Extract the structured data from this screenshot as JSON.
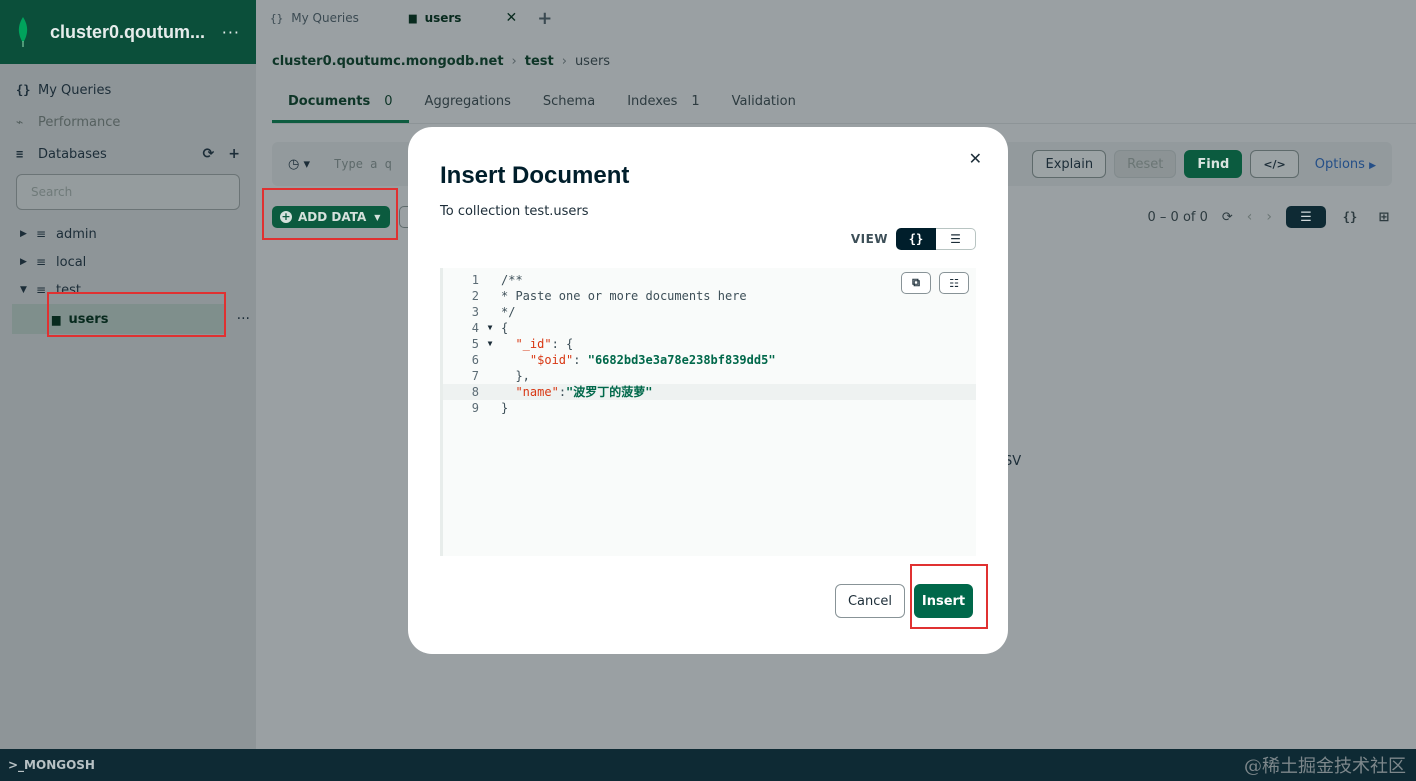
{
  "sidebar": {
    "connection_name": "cluster0.qoutum...",
    "nav": {
      "my_queries": "My Queries",
      "performance": "Performance",
      "databases": "Databases"
    },
    "search_placeholder": "Search",
    "databases": [
      {
        "name": "admin",
        "expanded": false
      },
      {
        "name": "local",
        "expanded": false
      },
      {
        "name": "test",
        "expanded": true
      }
    ],
    "collection": "users"
  },
  "tabs": [
    {
      "label": "My Queries",
      "icon": "braces-icon"
    },
    {
      "label": "users",
      "icon": "folder-icon",
      "active": true
    }
  ],
  "breadcrumb": {
    "cluster": "cluster0.qoutumc.mongodb.net",
    "database": "test",
    "collection": "users"
  },
  "subtabs": {
    "documents": "Documents",
    "documents_count": "0",
    "aggregations": "Aggregations",
    "schema": "Schema",
    "indexes": "Indexes",
    "indexes_count": "1",
    "validation": "Validation"
  },
  "querybar": {
    "placeholder": "Type a q",
    "explain": "Explain",
    "reset": "Reset",
    "find": "Find",
    "code_icon": "</>",
    "options": "Options"
  },
  "toolbar": {
    "add_data": "ADD DATA",
    "pager": "0 – 0 of 0"
  },
  "background_text": "SV",
  "modal": {
    "title": "Insert Document",
    "subtitle": "To collection test.users",
    "view_label": "VIEW",
    "code_lines": [
      {
        "n": "1",
        "text": "/**"
      },
      {
        "n": "2",
        "text": "* Paste one or more documents here"
      },
      {
        "n": "3",
        "text": "*/"
      },
      {
        "n": "4",
        "text": "{",
        "fold": true
      },
      {
        "n": "5",
        "key": "\"_id\"",
        "rest": ": {",
        "indent": "  ",
        "fold": true
      },
      {
        "n": "6",
        "key": "\"$oid\"",
        "rest": ": ",
        "value": "\"6682bd3e3a78e238bf839dd5\"",
        "indent": "    "
      },
      {
        "n": "7",
        "text": "  },"
      },
      {
        "n": "8",
        "key": "\"name\"",
        "rest": ":",
        "value": "\"波罗丁的菠萝\"",
        "indent": "  "
      },
      {
        "n": "9",
        "text": "}"
      }
    ],
    "cancel": "Cancel",
    "insert": "Insert"
  },
  "bottombar": {
    "label": ">_MONGOSH"
  },
  "watermark": "@稀土掘金技术社区"
}
